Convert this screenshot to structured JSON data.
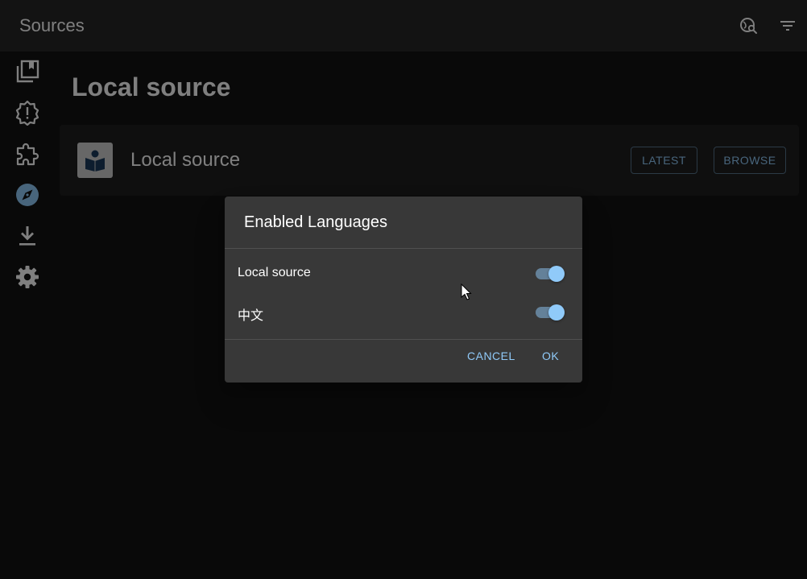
{
  "header": {
    "title": "Sources",
    "actions": [
      {
        "icon": "travel-explore-icon"
      },
      {
        "icon": "filter-list-icon"
      }
    ]
  },
  "sidebar": {
    "items": [
      {
        "icon": "library-icon",
        "active": false
      },
      {
        "icon": "updates-icon",
        "active": false
      },
      {
        "icon": "extensions-icon",
        "active": false
      },
      {
        "icon": "explore-icon",
        "active": true
      },
      {
        "icon": "download-icon",
        "active": false
      },
      {
        "icon": "settings-icon",
        "active": false
      }
    ]
  },
  "main": {
    "section_title": "Local source",
    "source": {
      "name": "Local source",
      "latest_label": "LATEST",
      "browse_label": "BROWSE"
    }
  },
  "dialog": {
    "title": "Enabled Languages",
    "languages": [
      {
        "label": "Local source",
        "enabled": true
      },
      {
        "label": "中文",
        "enabled": true
      }
    ],
    "cancel_label": "CANCEL",
    "ok_label": "OK"
  },
  "colors": {
    "accent": "#90caf9",
    "appbar": "#272727",
    "background": "#121212",
    "dialog": "#383838"
  }
}
